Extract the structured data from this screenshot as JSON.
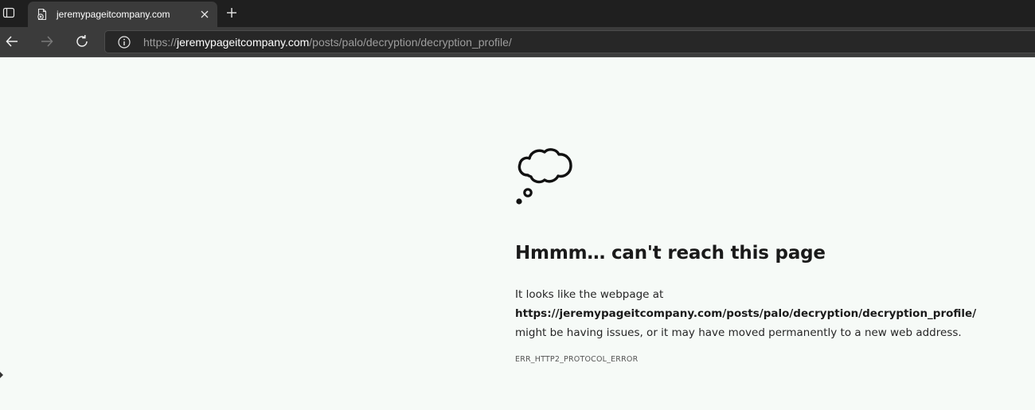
{
  "browser": {
    "tab": {
      "title": "jeremypageitcompany.com"
    },
    "address_bar": {
      "url_scheme": "https://",
      "url_host": "jeremypageitcompany.com",
      "url_path": "/posts/palo/decryption/decryption_profile/"
    },
    "icons": {
      "tab_actions": "tab-actions-icon",
      "favicon": "page-error-icon",
      "close": "close-icon",
      "new_tab": "plus-icon",
      "back": "back-arrow-icon",
      "forward": "forward-arrow-icon",
      "refresh": "refresh-icon",
      "site_info": "info-icon"
    }
  },
  "error_page": {
    "icon": "thought-cloud-icon",
    "title": "Hmmm… can't reach this page",
    "body_prefix": "It looks like the webpage at",
    "url": "https://jeremypageitcompany.com/posts/palo/decryption/decryption_profile/",
    "body_suffix": " might be having issues, or it may have moved permanently to a new web address.",
    "error_code": "ERR_HTTP2_PROTOCOL_ERROR"
  },
  "colors": {
    "page_background": "#f6faf7",
    "tabstrip_background": "#1f1f1f",
    "toolbar_background": "#3b3b3b",
    "address_background": "#272727"
  }
}
